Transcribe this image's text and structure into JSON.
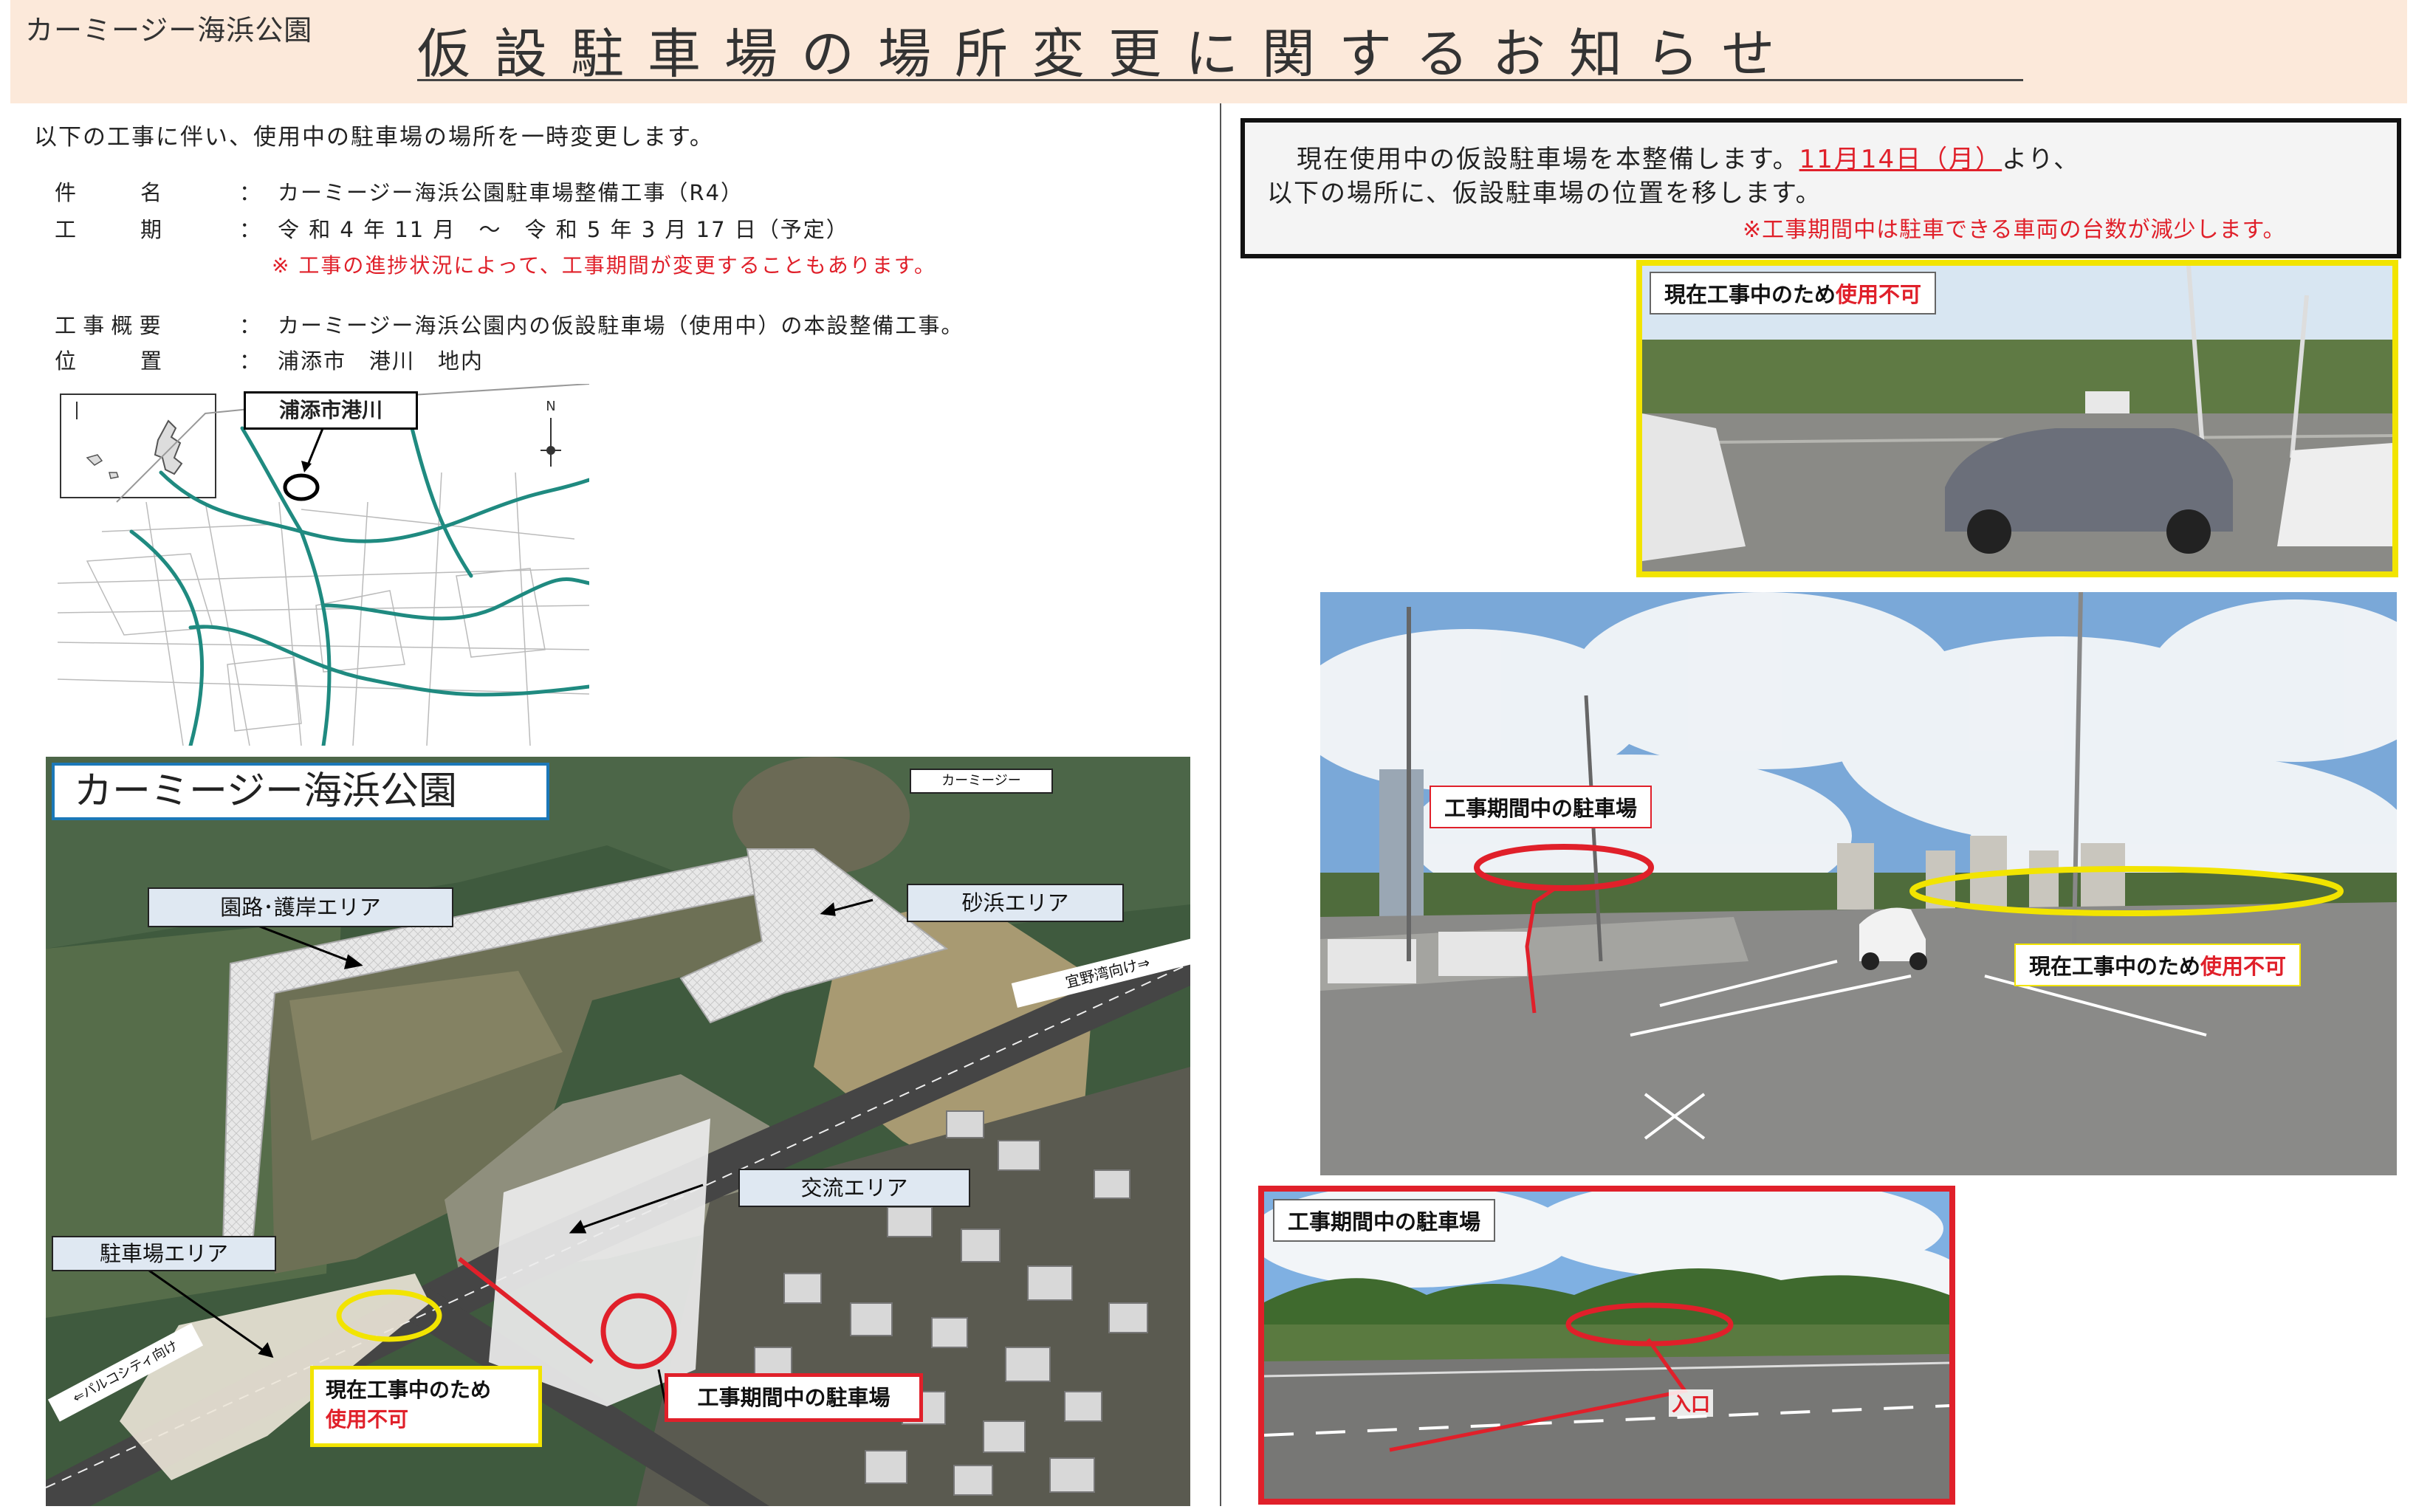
{
  "header": {
    "park_name": "カーミージー海浜公園",
    "title": "仮設駐車場の場所変更に関するお知らせ"
  },
  "left": {
    "intro": "以下の工事に伴い、使用中の駐車場の場所を一時変更します。",
    "rows": {
      "name_label": "件　　　名",
      "name_value": "カーミージー海浜公園駐車場整備工事（R4）",
      "period_label": "工　　　期",
      "period_value": "令 和 4 年 11 月　～　令 和 5 年 3 月 17 日（予定）",
      "period_note": "※ 工事の進捗状況によって、工事期間が変更することもあります。",
      "summary_label": "工 事 概 要",
      "summary_value": "カーミージー海浜公園内の仮設駐車場（使用中）の本設整備工事。",
      "location_label": "位　　　置",
      "location_value": "浦添市　港川　地内",
      "colon": "："
    },
    "map_label": "浦添市港川",
    "north": "N"
  },
  "aerial": {
    "title": "カーミージー海浜公園",
    "top_tag": "カーミージー",
    "tags": {
      "garden": "園路･護岸エリア",
      "beach": "砂浜エリア",
      "exchange": "交流エリア",
      "parking": "駐車場エリア"
    },
    "road_ginowan": "宜野湾向け⇒",
    "road_parco": "⇐パルコシティ向け",
    "badge_unavailable_1": "現在工事中のため",
    "badge_unavailable_2": "使用不可",
    "badge_construction": "工事期間中の駐車場"
  },
  "right": {
    "notice_line1_a": "現在使用中の仮設駐車場を本整備します。",
    "notice_date": "11月14日（月）",
    "notice_line1_b": "より、",
    "notice_line2": "以下の場所に、仮設駐車場の位置を移します。",
    "notice_note": "※工事期間中は駐車できる車両の台数が減少します。",
    "photo1_label_a": "現在工事中のため",
    "photo1_label_b": "使用不可",
    "photo2_label_left": "工事期間中の駐車場",
    "photo2_label_right_a": "現在工事中のため",
    "photo2_label_right_b": "使用不可",
    "photo3_label": "工事期間中の駐車場",
    "photo3_entrance": "入口"
  },
  "colors": {
    "header_bg": "#fce9da",
    "accent_red": "#e0202a",
    "accent_yellow": "#f2e400",
    "tag_bg": "#dfe8f2"
  }
}
